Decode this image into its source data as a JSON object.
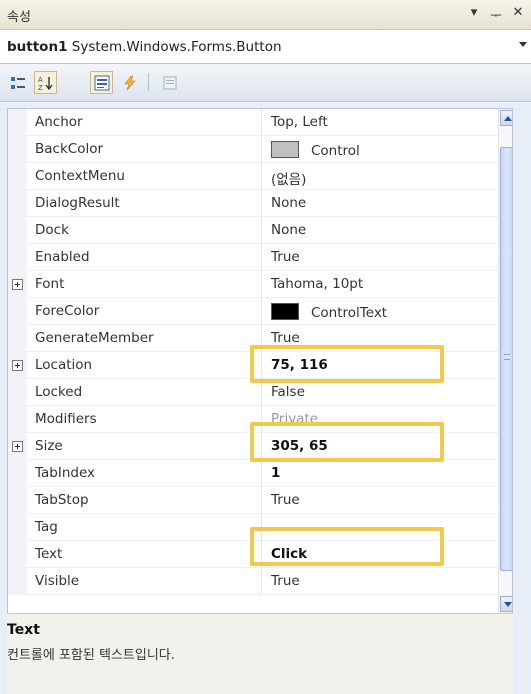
{
  "window": {
    "title": "속성",
    "controls": [
      "▾",
      "ᅮ",
      "✕"
    ]
  },
  "object_selector": {
    "name": "button1",
    "type": "System.Windows.Forms.Button"
  },
  "toolbar": {
    "buttons": [
      {
        "icon": "categorized-icon",
        "pressed": false
      },
      {
        "icon": "alphabetical-sort-icon",
        "pressed": true
      },
      {
        "icon": "properties-icon",
        "pressed": true
      },
      {
        "icon": "events-lightning-icon",
        "pressed": false
      },
      {
        "icon": "property-pages-icon",
        "pressed": false
      }
    ]
  },
  "properties": [
    {
      "name": "Anchor",
      "value": "Top, Left",
      "expandable": false
    },
    {
      "name": "BackColor",
      "value": "Control",
      "expandable": false,
      "swatch": "#c0c0c0"
    },
    {
      "name": "ContextMenu",
      "value": "(없음)",
      "expandable": false
    },
    {
      "name": "DialogResult",
      "value": "None",
      "expandable": false
    },
    {
      "name": "Dock",
      "value": "None",
      "expandable": false
    },
    {
      "name": "Enabled",
      "value": "True",
      "expandable": false
    },
    {
      "name": "Font",
      "value": "Tahoma, 10pt",
      "expandable": true
    },
    {
      "name": "ForeColor",
      "value": "ControlText",
      "expandable": false,
      "swatch": "#000000"
    },
    {
      "name": "GenerateMember",
      "value": "True",
      "expandable": false
    },
    {
      "name": "Location",
      "value": "75, 116",
      "expandable": true,
      "bold": true
    },
    {
      "name": "Locked",
      "value": "False",
      "expandable": false
    },
    {
      "name": "Modifiers",
      "value": "Private",
      "expandable": false,
      "faint": true
    },
    {
      "name": "Size",
      "value": "305, 65",
      "expandable": true,
      "bold": true
    },
    {
      "name": "TabIndex",
      "value": "1",
      "expandable": false,
      "bold": true
    },
    {
      "name": "TabStop",
      "value": "True",
      "expandable": false
    },
    {
      "name": "Tag",
      "value": "",
      "expandable": false
    },
    {
      "name": "Text",
      "value": "Click",
      "expandable": false,
      "bold": true
    },
    {
      "name": "Visible",
      "value": "True",
      "expandable": false
    }
  ],
  "description": {
    "title": "Text",
    "text": "컨트롤에 포함된 텍스트입니다."
  },
  "colors": {
    "highlight": "#f2c94c",
    "selected_toolbar": "#f6f1db"
  }
}
